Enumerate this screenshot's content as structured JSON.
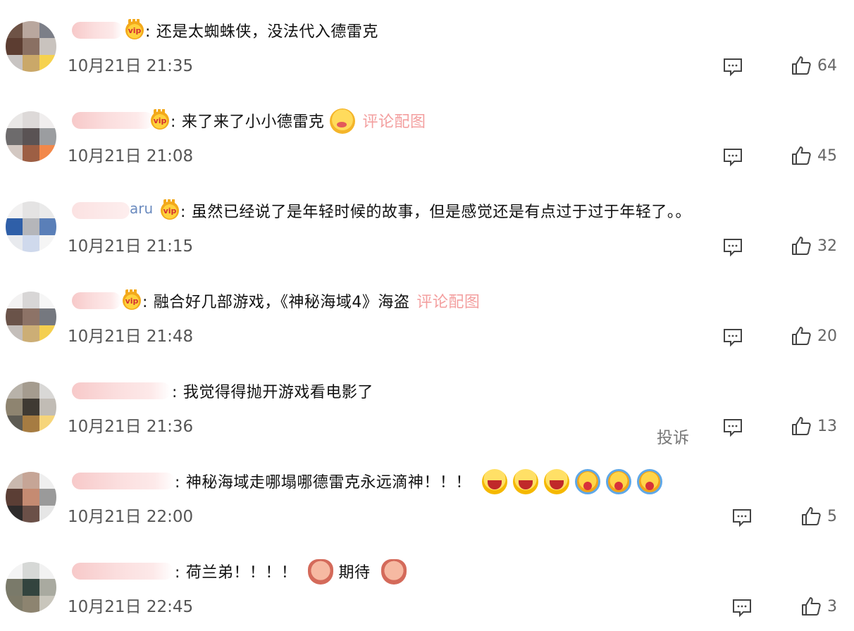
{
  "comments": [
    {
      "user_suffix": "",
      "text": "还是太蜘蛛侠，没法代入德雷克",
      "pic_link": "",
      "emojis": [],
      "time": "10月21日 21:35",
      "likes": "64",
      "report": ""
    },
    {
      "user_suffix": "",
      "text": "来了来了小小德雷克",
      "pic_link": "评论配图",
      "emojis": [
        "blush"
      ],
      "time": "10月21日 21:08",
      "likes": "45",
      "report": ""
    },
    {
      "user_suffix": "aru",
      "text": "虽然已经说了是年轻时候的故事，但是感觉还是有点过于过于年轻了。。",
      "pic_link": "",
      "emojis": [],
      "time": "10月21日 21:15",
      "likes": "32",
      "report": ""
    },
    {
      "user_suffix": "",
      "text": "融合好几部游戏，《神秘海域4》海盗",
      "pic_link": "评论配图",
      "emojis": [],
      "time": "10月21日 21:48",
      "likes": "20",
      "report": ""
    },
    {
      "user_suffix": "",
      "text": "我觉得得抛开游戏看电影了",
      "pic_link": "",
      "emojis": [],
      "time": "10月21日 21:36",
      "likes": "13",
      "report": "投诉"
    },
    {
      "user_suffix": "",
      "text": "神秘海域走哪塌哪德雷克永远滴神！！！",
      "pic_link": "",
      "emojis": [
        "laugh",
        "laugh",
        "laugh",
        "cry",
        "cry",
        "cry"
      ],
      "time": "10月21日 22:00",
      "likes": "5",
      "report": ""
    },
    {
      "user_suffix": "",
      "text": "荷兰弟！！！！",
      "text2": "期待",
      "pic_link": "",
      "emojis": [
        "doge"
      ],
      "time": "10月21日 22:45",
      "likes": "3",
      "report": ""
    }
  ],
  "colors": {
    "username_blur": "#f7c9c9",
    "pic_link": "#f08080",
    "time": "#555555",
    "icon": "#444444"
  },
  "icons": {
    "reply": "comment-bubble-icon",
    "like": "thumbs-up-icon",
    "vip": "vip-crown-icon"
  }
}
